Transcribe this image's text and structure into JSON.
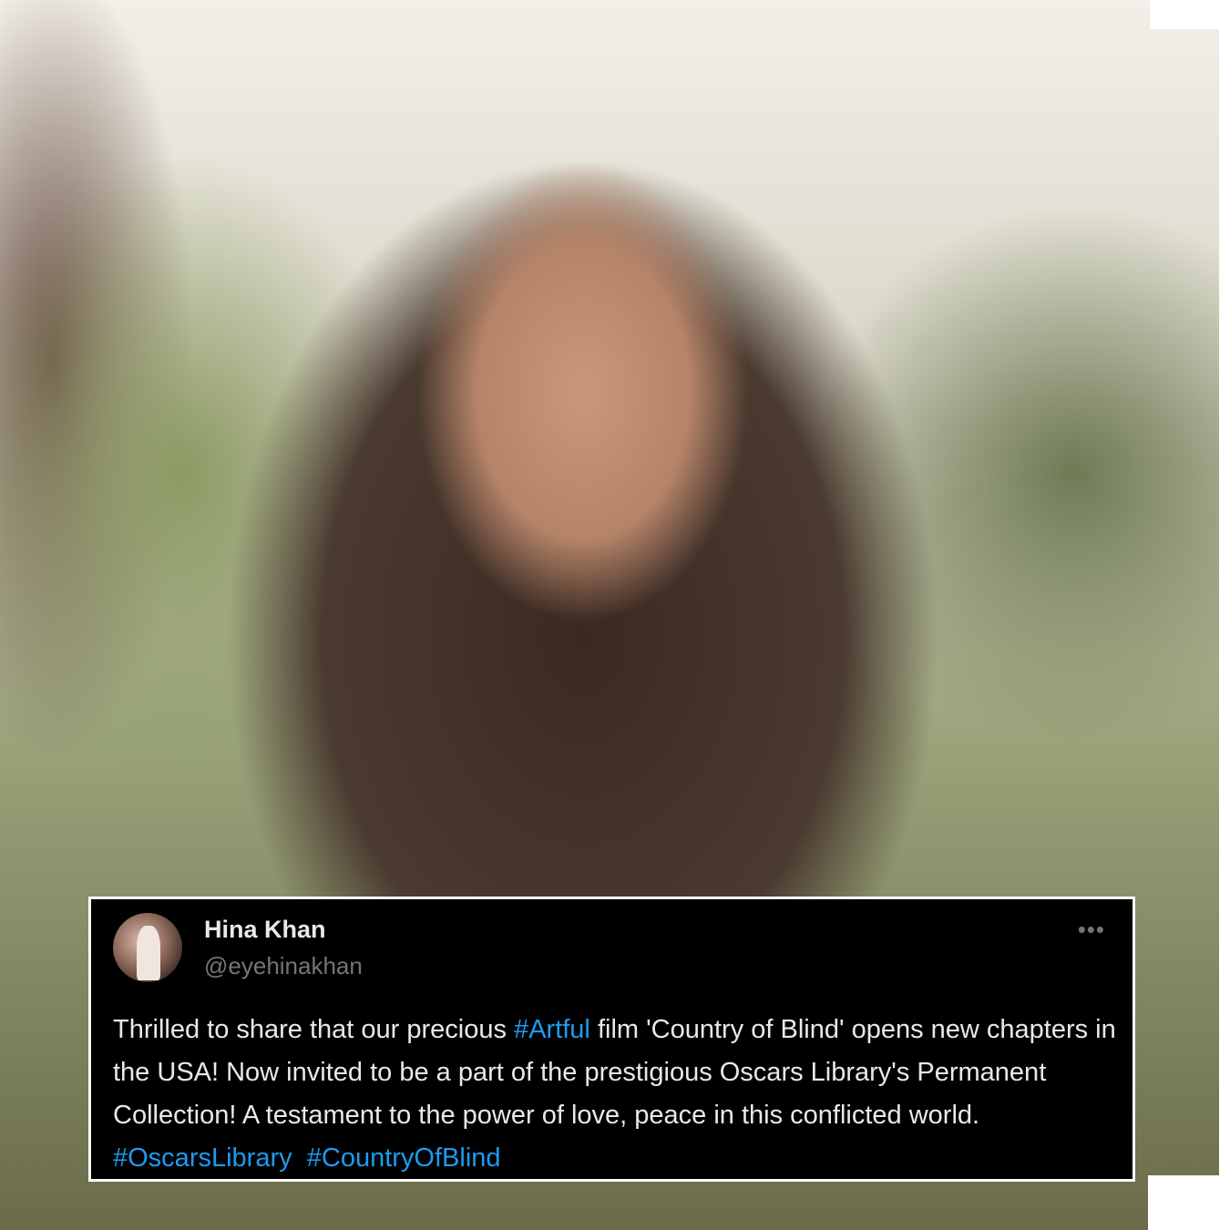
{
  "tweet": {
    "display_name": "Hina Khan",
    "handle": "@eyehinakhan",
    "more_icon": "more-horizontal-icon",
    "text_parts": [
      "Thrilled to share that our precious ",
      "#Artful",
      " film 'Country of Blind' opens new chapters in the USA! Now invited to be a part of the prestigious Oscars Library's Permanent Collection! A testament to the power of love, peace in this conflicted world. ",
      "#OscarsLibrary",
      "  ",
      "#CountryOfBlind"
    ]
  },
  "colors": {
    "card_bg": "#000000",
    "text": "#e7e9ea",
    "secondary": "#71767b",
    "hashtag": "#1d9bf0"
  }
}
